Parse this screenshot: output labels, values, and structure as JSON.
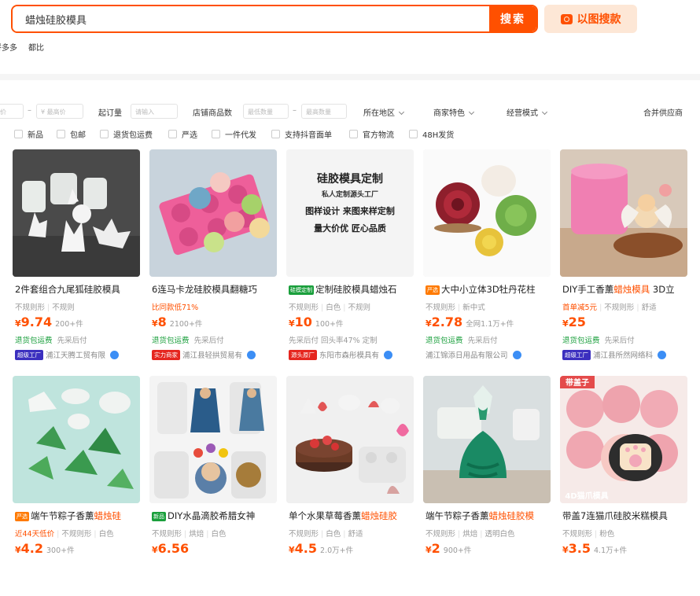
{
  "search": {
    "value": "蜡烛硅胶模具",
    "button": "搜索",
    "image_search": "以图搜款"
  },
  "sublinks": [
    "拼多多",
    "都比"
  ],
  "filters": {
    "price_min": "价",
    "price_max": "¥ 最高价",
    "dash": "–",
    "min_order_label": "起订量",
    "min_order_placeholder": "请输入",
    "shop_items_label": "店铺商品数",
    "shop_min": "最低数量",
    "shop_max": "最高数量",
    "region": "所在地区",
    "merchant": "商家特色",
    "mode": "经营模式",
    "merge": "合并供应商"
  },
  "checks": [
    "新品",
    "包邮",
    "退货包运费",
    "严选",
    "一件代发",
    "支持抖音面单",
    "官方物流",
    "48H发货"
  ],
  "colors": {
    "accent": "#ff5000",
    "green": "#1a9f3c"
  },
  "products": [
    {
      "tag": "",
      "title_pre": "2件套组合九尾狐硅胶模具",
      "title_hl": "",
      "title_post": "",
      "attrs": [
        "不规则形",
        "不规则"
      ],
      "attr_hl": "",
      "price": "9.74",
      "sold": "200+件",
      "service_g": "退货包运费",
      "service_gr": "先采后付",
      "badge": "超级工厂",
      "shop": "浦江天腾工贸有限"
    },
    {
      "tag": "",
      "title_pre": "6连马卡龙硅胶模具翻糖巧",
      "title_hl": "",
      "title_post": "",
      "attrs": [],
      "attr_hl": "比同款低71%",
      "price": "8",
      "sold": "2100+件",
      "service_g": "退货包运费",
      "service_gr": "先采后付",
      "badge": "实力商家",
      "shop": "浦江县轻拱贸易有"
    },
    {
      "tag": "硅模定制",
      "title_pre": "定制硅胶模具蜡烛石",
      "title_hl": "",
      "title_post": "",
      "attrs": [
        "不规则形",
        "白色",
        "不规则"
      ],
      "attr_hl": "",
      "price": "10",
      "sold": "100+件",
      "service_g": "",
      "service_gr": "先采后付  回头率47%  定制",
      "badge": "源头原厂",
      "shop": "东阳市森彤模具有"
    },
    {
      "tag": "严选",
      "title_pre": "大中小立体3D牡丹花柱",
      "title_hl": "",
      "title_post": "",
      "attrs": [
        "不规则形",
        "新中式"
      ],
      "attr_hl": "",
      "price": "2.78",
      "sold": "全网1.1万+件",
      "service_g": "退货包运费",
      "service_gr": "先采后付",
      "badge": "",
      "shop": "浦江锦添日用品有限公司"
    },
    {
      "tag": "",
      "title_pre": "DIY手工香薰",
      "title_hl": "蜡烛模具",
      "title_post": " 3D立",
      "attrs": [
        "不规则形",
        "舒适"
      ],
      "attr_hl": "首单减5元",
      "price": "25",
      "sold": "",
      "service_g": "退货包运费",
      "service_gr": "先采后付",
      "badge": "超级工厂",
      "shop": "浦江县所然网络科"
    },
    {
      "tag": "严选",
      "title_pre": "端午节粽子香薰",
      "title_hl": "蜡烛硅",
      "title_post": "",
      "attrs": [
        "不规则形",
        "白色"
      ],
      "attr_hl": "近44天低价",
      "price": "4.2",
      "sold": "300+件",
      "service_g": "",
      "service_gr": "",
      "badge": "",
      "shop": ""
    },
    {
      "tag": "新品",
      "title_pre": "DIY水晶滴胶希腊女神",
      "title_hl": "",
      "title_post": "",
      "attrs": [
        "不规则形",
        "烘焙",
        "白色"
      ],
      "attr_hl": "",
      "price": "6.56",
      "sold": "",
      "service_g": "",
      "service_gr": "",
      "badge": "",
      "shop": ""
    },
    {
      "tag": "",
      "title_pre": "单个水果草莓香薰",
      "title_hl": "蜡烛硅胶",
      "title_post": "",
      "attrs": [
        "不规则形",
        "白色",
        "舒适"
      ],
      "attr_hl": "",
      "price": "4.5",
      "sold": "2.0万+件",
      "service_g": "",
      "service_gr": "",
      "badge": "",
      "shop": ""
    },
    {
      "tag": "",
      "title_pre": "端午节粽子香薰",
      "title_hl": "蜡烛硅胶模",
      "title_post": "",
      "attrs": [
        "不规则形",
        "烘焙",
        "透明白色"
      ],
      "attr_hl": "",
      "price": "2",
      "sold": "900+件",
      "service_g": "",
      "service_gr": "",
      "badge": "",
      "shop": ""
    },
    {
      "tag": "",
      "title_pre": "带盖7连猫爪硅胶米糕模具",
      "title_hl": "",
      "title_post": "",
      "attrs": [
        "不规则形",
        "粉色"
      ],
      "attr_hl": "",
      "price": "3.5",
      "sold": "4.1万+件",
      "service_g": "",
      "service_gr": "",
      "badge": "",
      "shop": ""
    }
  ],
  "image_texts": {
    "p3_line1": "硅胶模具定制",
    "p3_line2": "私人定制源头工厂",
    "p3_line3": "图样设计  来图来样定制",
    "p3_line4": "量大价优  匠心品质",
    "p10_top": "带盖子",
    "p10_bottom": "4D猫爪模具"
  }
}
